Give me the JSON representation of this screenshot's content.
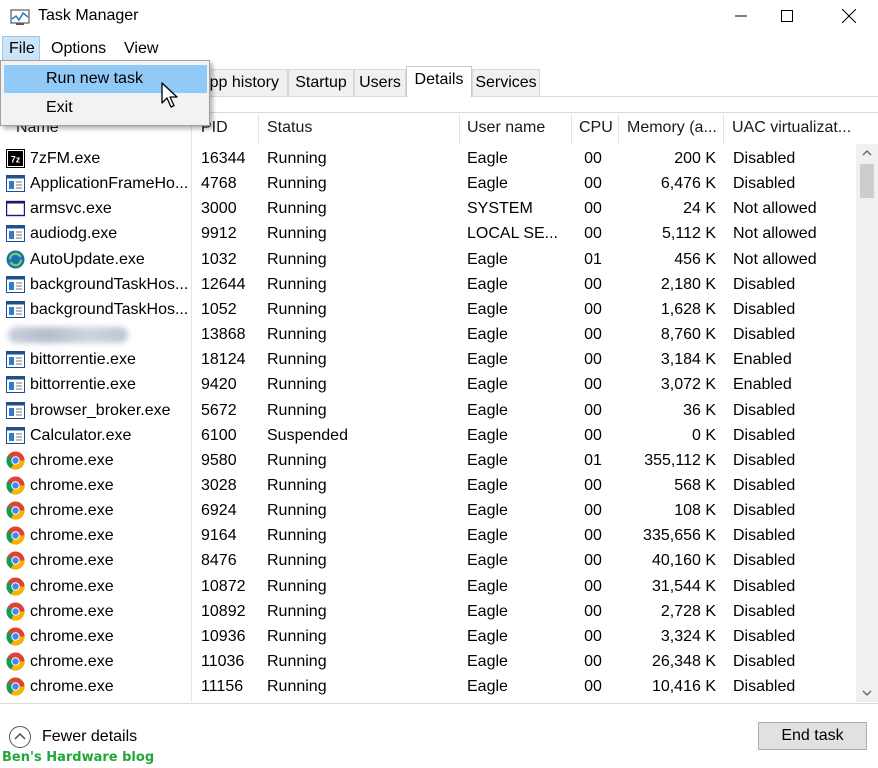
{
  "window": {
    "title": "Task Manager"
  },
  "menu": {
    "file": "File",
    "options": "Options",
    "view": "View"
  },
  "file_menu": {
    "items": [
      "Run new task",
      "Exit"
    ]
  },
  "tabs": [
    "pp history",
    "Startup",
    "Users",
    "Details",
    "Services"
  ],
  "active_tab": "Details",
  "columns": {
    "name": "Name",
    "pid": "PID",
    "status": "Status",
    "user": "User name",
    "cpu": "CPU",
    "memory": "Memory (a...",
    "uac": "UAC virtualizat..."
  },
  "rows": [
    {
      "icon": "7zip-icon",
      "name": "7zFM.exe",
      "pid": "16344",
      "status": "Running",
      "user": "Eagle",
      "cpu": "00",
      "mem": "200 K",
      "uac": "Disabled"
    },
    {
      "icon": "app-window-icon",
      "name": "ApplicationFrameHo...",
      "pid": "4768",
      "status": "Running",
      "user": "Eagle",
      "cpu": "00",
      "mem": "6,476 K",
      "uac": "Disabled"
    },
    {
      "icon": "blank-window-icon",
      "name": "armsvc.exe",
      "pid": "3000",
      "status": "Running",
      "user": "SYSTEM",
      "cpu": "00",
      "mem": "24 K",
      "uac": "Not allowed"
    },
    {
      "icon": "app-window-icon",
      "name": "audiodg.exe",
      "pid": "9912",
      "status": "Running",
      "user": "LOCAL SE...",
      "cpu": "00",
      "mem": "5,112 K",
      "uac": "Not allowed"
    },
    {
      "icon": "update-globe-icon",
      "name": "AutoUpdate.exe",
      "pid": "1032",
      "status": "Running",
      "user": "Eagle",
      "cpu": "01",
      "mem": "456 K",
      "uac": "Not allowed"
    },
    {
      "icon": "app-window-icon",
      "name": "backgroundTaskHos...",
      "pid": "12644",
      "status": "Running",
      "user": "Eagle",
      "cpu": "00",
      "mem": "2,180 K",
      "uac": "Disabled"
    },
    {
      "icon": "app-window-icon",
      "name": "backgroundTaskHos...",
      "pid": "1052",
      "status": "Running",
      "user": "Eagle",
      "cpu": "00",
      "mem": "1,628 K",
      "uac": "Disabled"
    },
    {
      "icon": "blurred",
      "name": "",
      "pid": "13868",
      "status": "Running",
      "user": "Eagle",
      "cpu": "00",
      "mem": "8,760 K",
      "uac": "Disabled"
    },
    {
      "icon": "app-window-icon",
      "name": "bittorrentie.exe",
      "pid": "18124",
      "status": "Running",
      "user": "Eagle",
      "cpu": "00",
      "mem": "3,184 K",
      "uac": "Enabled"
    },
    {
      "icon": "app-window-icon",
      "name": "bittorrentie.exe",
      "pid": "9420",
      "status": "Running",
      "user": "Eagle",
      "cpu": "00",
      "mem": "3,072 K",
      "uac": "Enabled"
    },
    {
      "icon": "app-window-icon",
      "name": "browser_broker.exe",
      "pid": "5672",
      "status": "Running",
      "user": "Eagle",
      "cpu": "00",
      "mem": "36 K",
      "uac": "Disabled"
    },
    {
      "icon": "app-window-icon",
      "name": "Calculator.exe",
      "pid": "6100",
      "status": "Suspended",
      "user": "Eagle",
      "cpu": "00",
      "mem": "0 K",
      "uac": "Disabled"
    },
    {
      "icon": "chrome-icon",
      "name": "chrome.exe",
      "pid": "9580",
      "status": "Running",
      "user": "Eagle",
      "cpu": "01",
      "mem": "355,112 K",
      "uac": "Disabled"
    },
    {
      "icon": "chrome-icon",
      "name": "chrome.exe",
      "pid": "3028",
      "status": "Running",
      "user": "Eagle",
      "cpu": "00",
      "mem": "568 K",
      "uac": "Disabled"
    },
    {
      "icon": "chrome-icon",
      "name": "chrome.exe",
      "pid": "6924",
      "status": "Running",
      "user": "Eagle",
      "cpu": "00",
      "mem": "108 K",
      "uac": "Disabled"
    },
    {
      "icon": "chrome-icon",
      "name": "chrome.exe",
      "pid": "9164",
      "status": "Running",
      "user": "Eagle",
      "cpu": "00",
      "mem": "335,656 K",
      "uac": "Disabled"
    },
    {
      "icon": "chrome-icon",
      "name": "chrome.exe",
      "pid": "8476",
      "status": "Running",
      "user": "Eagle",
      "cpu": "00",
      "mem": "40,160 K",
      "uac": "Disabled"
    },
    {
      "icon": "chrome-icon",
      "name": "chrome.exe",
      "pid": "10872",
      "status": "Running",
      "user": "Eagle",
      "cpu": "00",
      "mem": "31,544 K",
      "uac": "Disabled"
    },
    {
      "icon": "chrome-icon",
      "name": "chrome.exe",
      "pid": "10892",
      "status": "Running",
      "user": "Eagle",
      "cpu": "00",
      "mem": "2,728 K",
      "uac": "Disabled"
    },
    {
      "icon": "chrome-icon",
      "name": "chrome.exe",
      "pid": "10936",
      "status": "Running",
      "user": "Eagle",
      "cpu": "00",
      "mem": "3,324 K",
      "uac": "Disabled"
    },
    {
      "icon": "chrome-icon",
      "name": "chrome.exe",
      "pid": "11036",
      "status": "Running",
      "user": "Eagle",
      "cpu": "00",
      "mem": "26,348 K",
      "uac": "Disabled"
    },
    {
      "icon": "chrome-icon",
      "name": "chrome.exe",
      "pid": "11156",
      "status": "Running",
      "user": "Eagle",
      "cpu": "00",
      "mem": "10,416 K",
      "uac": "Disabled"
    }
  ],
  "footer": {
    "fewer_details": "Fewer details",
    "end_task": "End task",
    "watermark": "Ben's Hardware blog"
  }
}
